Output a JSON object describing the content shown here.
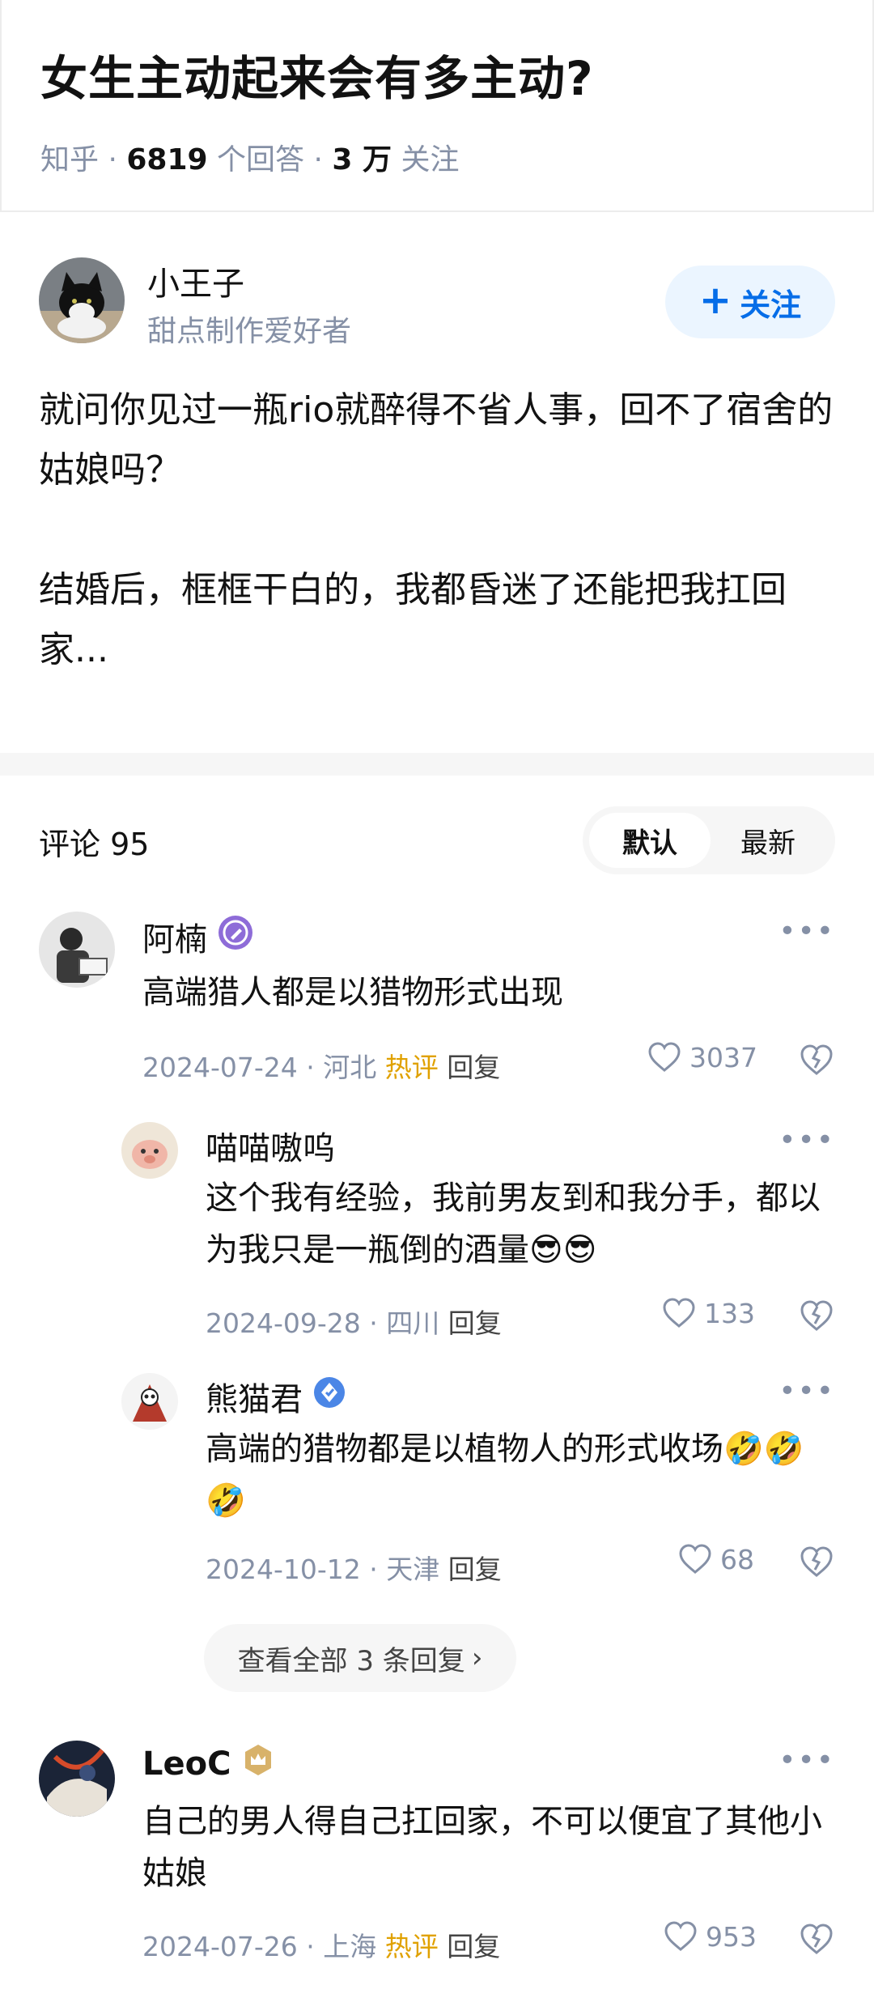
{
  "question": {
    "title": "女生主动起来会有多主动?",
    "source": "知乎",
    "answer_count": "6819",
    "answer_label": "个回答",
    "follow_count": "3 万",
    "follow_label": "关注"
  },
  "author": {
    "name": "小王子",
    "bio": "甜点制作爱好者",
    "follow_button": "关注"
  },
  "answer": {
    "paragraphs": [
      "就问你见过一瓶rio就醉得不省人事，回不了宿舍的姑娘吗？",
      "结婚后，框框干白的，我都昏迷了还能把我扛回家..."
    ]
  },
  "comments_section": {
    "label": "评论",
    "count": "95",
    "sort_default": "默认",
    "sort_latest": "最新"
  },
  "comments": [
    {
      "name": "阿楠",
      "badge": "pen-badge-icon",
      "text": "高端猎人都是以猎物形式出现",
      "date": "2024-07-24",
      "location": "河北",
      "hot": "热评",
      "reply": "回复",
      "likes": "3037"
    },
    {
      "name": "喵喵嗷呜",
      "text": "这个我有经验，我前男友到和我分手，都以为我只是一瓶倒的酒量😎😎",
      "date": "2024-09-28",
      "location": "四川",
      "reply": "回复",
      "likes": "133"
    },
    {
      "name": "熊猫君",
      "badge": "verified-badge-icon",
      "text": "高端的猎物都是以植物人的形式收场🤣🤣🤣",
      "date": "2024-10-12",
      "location": "天津",
      "reply": "回复",
      "likes": "68"
    },
    {
      "name": "LeoC",
      "badge": "crown-badge-icon",
      "text": "自己的男人得自己扛回家，不可以便宜了其他小姑娘",
      "date": "2024-07-26",
      "location": "上海",
      "hot": "热评",
      "reply": "回复",
      "likes": "953"
    }
  ],
  "view_all_replies": "查看全部 3 条回复",
  "separator": "·",
  "colors": {
    "accent": "#056de8",
    "hot": "#e0a100",
    "muted": "#8590a6"
  }
}
